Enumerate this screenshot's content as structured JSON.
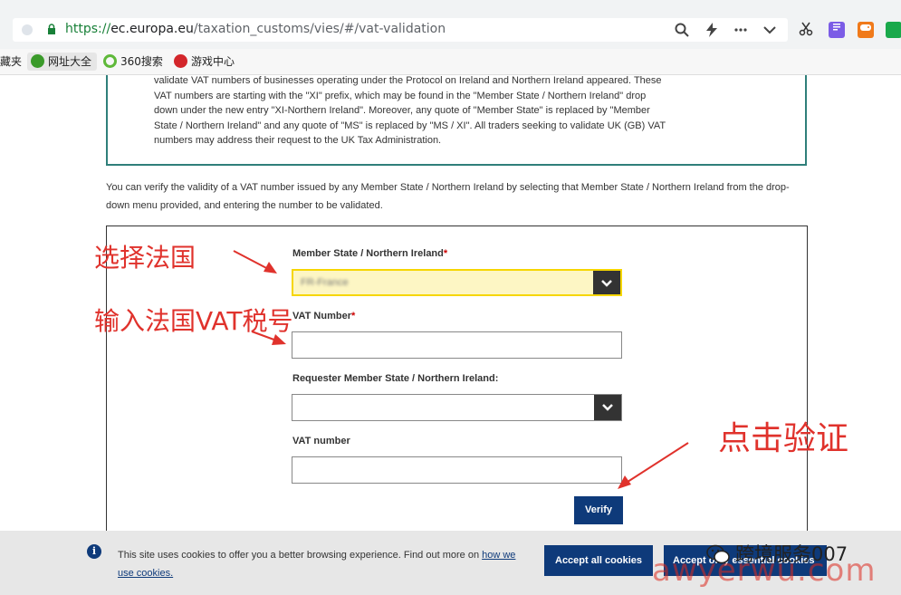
{
  "browser": {
    "url_scheme": "https://",
    "url_host": "ec.europa.eu",
    "url_path": "/taxation_customs/vies/#/vat-validation",
    "toolbar_icons": [
      "search-icon",
      "lightning-icon",
      "more-icon",
      "chevron-down-icon",
      "scissors-icon",
      "note-extension-icon",
      "game-extension-icon",
      "wechat-extension-icon"
    ]
  },
  "bookmarks": {
    "items": [
      {
        "label": "藏夹"
      },
      {
        "label": "网址大全"
      },
      {
        "label": "360搜索"
      },
      {
        "label": "游戏中心"
      }
    ]
  },
  "notice": {
    "text": "validate VAT numbers of businesses operating under the Protocol on Ireland and Northern Ireland appeared. These VAT numbers are starting with the \"XI\" prefix, which may be found in the \"Member State / Northern Ireland\" drop down under the new entry \"XI-Northern Ireland\". Moreover, any quote of \"Member State\" is replaced by \"Member State / Northern Ireland\" and any quote of \"MS\" is replaced by \"MS / XI\". All traders seeking to validate UK (GB) VAT numbers may address their request to the UK Tax Administration."
  },
  "intro": "You can verify the validity of a VAT number issued by any Member State / Northern Ireland by selecting that Member State / Northern Ireland from the drop-down menu provided, and entering the number to be validated.",
  "form": {
    "member_state_label": "Member State / Northern Ireland",
    "member_state_value": "FR-France",
    "vat_number_label": "VAT Number",
    "required_mark": "*",
    "requester_state_label": "Requester Member State / Northern Ireland:",
    "requester_state_value": "",
    "requester_vat_label": "VAT number",
    "verify_label": "Verify"
  },
  "cookie": {
    "text": "This site uses cookies to offer you a better browsing experience. Find out more on ",
    "link": "how we use cookies.",
    "accept_all": "Accept all cookies",
    "accept_only": "Accept only essential cookies"
  },
  "annotations": {
    "select_france": "选择法国",
    "enter_vat": "输入法国VAT税号",
    "click_verify": "点击验证",
    "color": "#e0322c"
  },
  "watermark": {
    "account": "跨境服务007",
    "site": "awyerwu.com"
  }
}
